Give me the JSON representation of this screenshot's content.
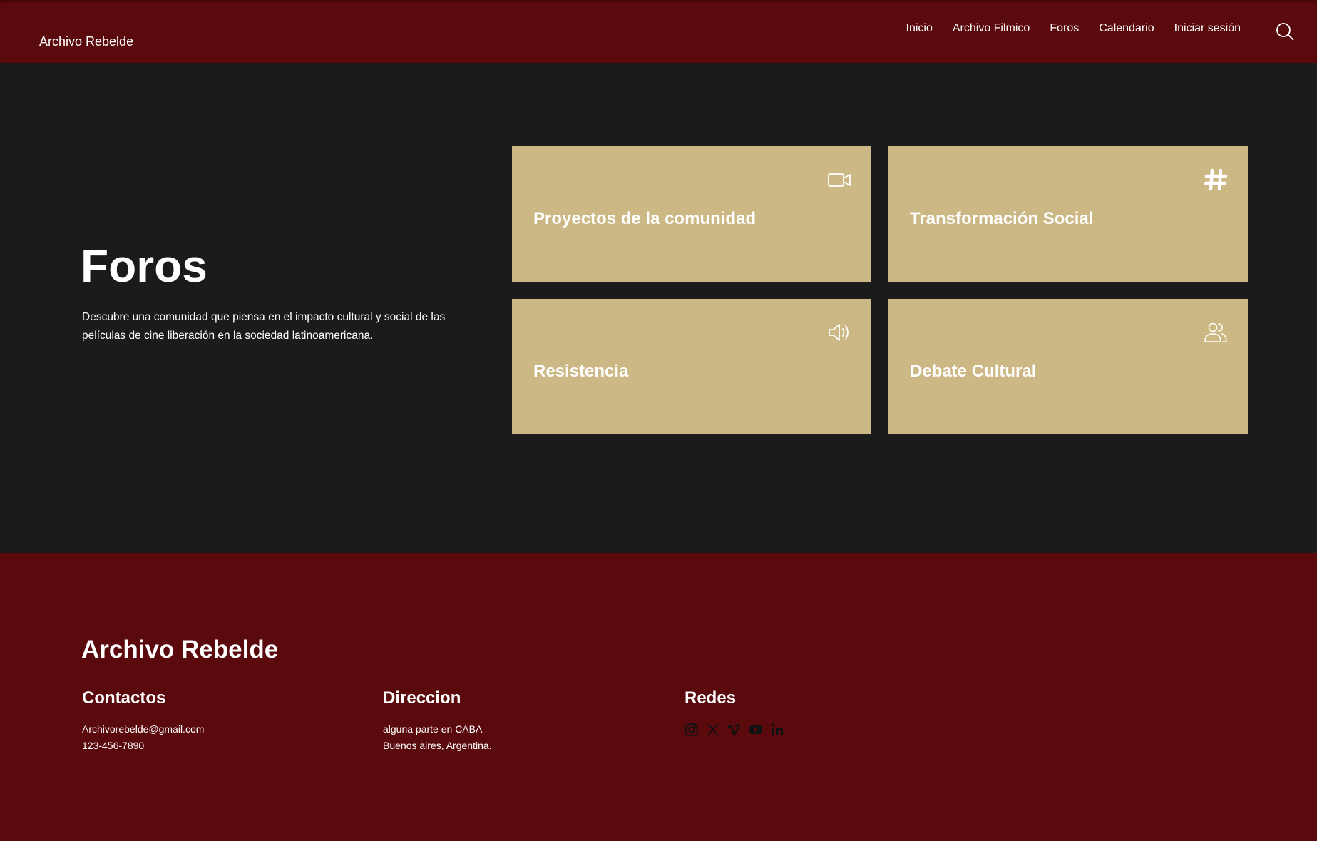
{
  "header": {
    "brand": "Archivo Rebelde",
    "nav": [
      "Inicio",
      "Archivo Filmico",
      "Foros",
      "Calendario",
      "Iniciar sesión"
    ],
    "active_nav": "Foros",
    "search_icon": "search-icon"
  },
  "main": {
    "title": "Foros",
    "description": "Descubre una comunidad que piensa en el impacto cultural y social de las películas de cine liberación en la sociedad latinoamericana.",
    "cards": [
      {
        "title": "Proyectos de la comunidad",
        "icon": "video-camera-icon"
      },
      {
        "title": "Transformación Social",
        "icon": "hashtag-icon"
      },
      {
        "title": "Resistencia",
        "icon": "speaker-icon"
      },
      {
        "title": "Debate Cultural",
        "icon": "users-icon"
      }
    ]
  },
  "footer": {
    "brand": "Archivo Rebelde",
    "contactos": {
      "heading": "Contactos",
      "lines": [
        "Archivorebelde@gmail.com",
        "123-456-7890"
      ]
    },
    "direccion": {
      "heading": "Direccion",
      "lines": [
        "alguna parte en CABA",
        "Buenos aires, Argentina."
      ]
    },
    "redes": {
      "heading": "Redes",
      "icons": [
        "instagram-icon",
        "x-icon",
        "vimeo-icon",
        "youtube-icon",
        "linkedin-icon"
      ]
    }
  },
  "colors": {
    "header_bg": "#5a090c",
    "main_bg": "#1b1b1b",
    "card_bg": "#cbb884",
    "text": "#ffffff"
  }
}
